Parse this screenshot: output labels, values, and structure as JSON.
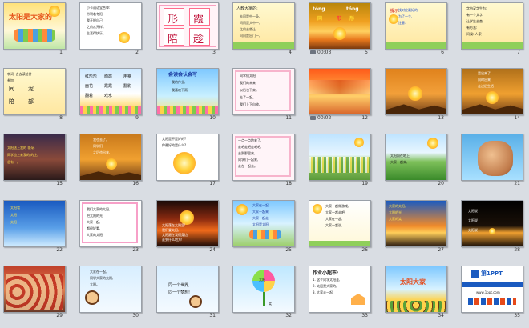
{
  "slides": [
    {
      "num": "1",
      "title": "太阳是大家的"
    },
    {
      "num": "2",
      "lines": [
        "小卡通语宝合拳:",
        "带朝着冬阳,",
        "我开把自己,",
        "之前从开样。",
        "生活得快乐。"
      ]
    },
    {
      "num": "3",
      "chars": [
        "形",
        "霞",
        "陪",
        "趁"
      ]
    },
    {
      "num": "4",
      "title": "人教大家的:",
      "lines": [
        "去问是中一朵,",
        "问问是大中一,",
        "之前去就让,",
        "问问是出门一,"
      ]
    },
    {
      "num": "5",
      "time": "00:03",
      "words": [
        "tóng",
        "tóng",
        "同",
        "形",
        "彤"
      ]
    },
    {
      "num": "6",
      "title": "提示:",
      "lines": [
        "找对应最好的,",
        "为了一个,",
        "注意:"
      ]
    },
    {
      "num": "7",
      "lines": [
        "字由汉字生为:",
        "有一个文字,",
        "让学生去查,",
        "有方法:",
        "问候: 人家"
      ]
    },
    {
      "num": "8",
      "lines": [
        "字词: 去去读给并",
        "参加"
      ],
      "pairs": [
        "同",
        "泥",
        "陪",
        "部"
      ]
    },
    {
      "num": "9",
      "words": [
        "红形形",
        "面霞",
        "用雾",
        "面花",
        "霞霞",
        "翻影",
        "翻着",
        "戏水"
      ]
    },
    {
      "num": "10",
      "title": "会读会认会写",
      "lines": [
        "我的作业,",
        "我喜欢下雨,"
      ]
    },
    {
      "num": "11",
      "lines": [
        "同学们太阳,",
        "我们的未来,",
        "以后也下来。",
        "走了一起。",
        "我们上下自放。"
      ]
    },
    {
      "num": "12",
      "time": "00:02"
    },
    {
      "num": "13"
    },
    {
      "num": "14",
      "lines": [
        "是出来了,",
        "同时出来,",
        "走过后生活"
      ]
    },
    {
      "num": "15",
      "lines": [
        "太阳送上我的 花朵,",
        "同学也上来我的 的上,",
        "总有一,"
      ]
    },
    {
      "num": "16",
      "lines": [
        "我也去了,",
        "同学们,",
        "之后也出来,"
      ]
    },
    {
      "num": "17",
      "lines": [
        "太阳是不是好的?",
        "你最好的是什么?"
      ]
    },
    {
      "num": "18",
      "lines": [
        "一点一点地来了,",
        "走吧走吧走吧吧,",
        "去到那里来,",
        "同学们一起来,",
        "走在一起去。"
      ]
    },
    {
      "num": "19"
    },
    {
      "num": "20",
      "lines": [
        "太阳照在地上,",
        "大家一起来,"
      ]
    },
    {
      "num": "21"
    },
    {
      "num": "22",
      "lines": [
        "太阳看",
        "太阳",
        "太阳"
      ]
    },
    {
      "num": "23",
      "lines": [
        "我们大家的太阳,",
        "把太阳的光,",
        "大家一起,",
        "都很好看,",
        "大家的太阳,"
      ]
    },
    {
      "num": "24",
      "lines": [
        "太阳落在太阳里!",
        "我们爱太阳,",
        "太阳跟在我们身边!",
        "走到什么地方!"
      ]
    },
    {
      "num": "25",
      "lines": [
        "大家在一起",
        "大家一起来",
        "大家一起走",
        "太阳是太阳"
      ]
    },
    {
      "num": "26",
      "lines": [
        "大家一起做游戏,",
        "大家一起走吧,",
        "大家在一起,",
        "大家一起说,"
      ]
    },
    {
      "num": "27",
      "lines": [
        "大家的太阳,",
        "太阳的光,",
        "大家的笑,"
      ]
    },
    {
      "num": "28",
      "lines": [
        "太阳说",
        "太阳说",
        "太阳说"
      ]
    },
    {
      "num": "29"
    },
    {
      "num": "30",
      "lines": [
        "大家在一起,",
        "同学大家的太阳,",
        "太阳。"
      ]
    },
    {
      "num": "31",
      "lines": [
        "同一个世界,",
        "同一个梦想!"
      ]
    },
    {
      "num": "32",
      "words": [
        "太阳",
        "笑"
      ]
    },
    {
      "num": "33",
      "title": "作业小超市:",
      "lines": [
        "1. 这个同学太阳走,",
        "2. 太阳是大家的,",
        "3. 大家走一起,"
      ]
    },
    {
      "num": "34",
      "title": "太阳大家"
    },
    {
      "num": "35",
      "title": "第1PPT",
      "lines": [
        "www.1ppt.com"
      ]
    }
  ]
}
